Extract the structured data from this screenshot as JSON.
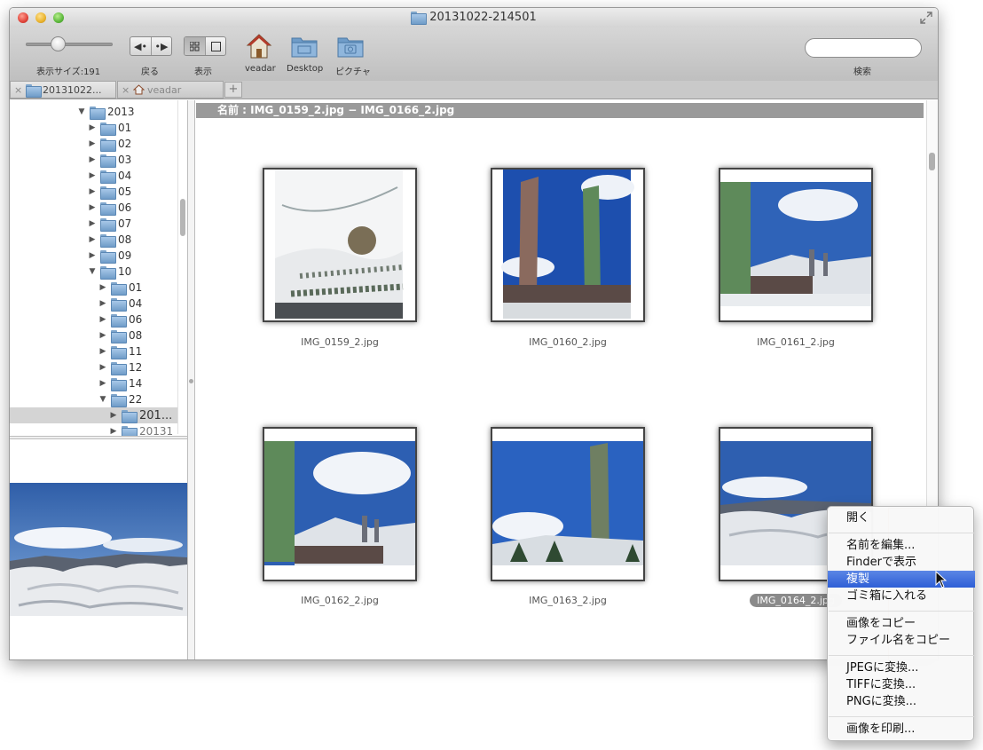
{
  "window": {
    "title": "20131022-214501"
  },
  "toolbar": {
    "size_label": "表示サイズ:191",
    "back_label": "戻る",
    "view_label": "表示",
    "back_glyphs": [
      "◀•",
      "•▶"
    ],
    "veadar_label": "veadar",
    "desktop_label": "Desktop",
    "pictures_label": "ピクチャ",
    "search_label": "検索",
    "search_value": ""
  },
  "tabs": [
    {
      "label": "20131022..."
    },
    {
      "label": "veadar"
    }
  ],
  "tree": [
    {
      "label": "2013"
    },
    {
      "label": "01"
    },
    {
      "label": "02"
    },
    {
      "label": "03"
    },
    {
      "label": "04"
    },
    {
      "label": "05"
    },
    {
      "label": "06"
    },
    {
      "label": "07"
    },
    {
      "label": "08"
    },
    {
      "label": "09"
    },
    {
      "label": "10"
    },
    {
      "label": "01"
    },
    {
      "label": "04"
    },
    {
      "label": "06"
    },
    {
      "label": "08"
    },
    {
      "label": "11"
    },
    {
      "label": "12"
    },
    {
      "label": "14"
    },
    {
      "label": "22"
    },
    {
      "label": "201..."
    },
    {
      "label": "20131"
    }
  ],
  "content": {
    "header": "名前 : IMG_0159_2.jpg − IMG_0166_2.jpg",
    "thumbnails": [
      {
        "name": "IMG_0159_2.jpg"
      },
      {
        "name": "IMG_0160_2.jpg"
      },
      {
        "name": "IMG_0161_2.jpg"
      },
      {
        "name": "IMG_0162_2.jpg"
      },
      {
        "name": "IMG_0163_2.jpg"
      },
      {
        "name": "IMG_0164_2.jpg"
      }
    ]
  },
  "context_menu": {
    "items": [
      "開く",
      "名前を編集...",
      "Finderで表示",
      "複製",
      "ゴミ箱に入れる",
      "画像をコピー",
      "ファイル名をコピー",
      "JPEGに変換...",
      "TIFFに変換...",
      "PNGに変換...",
      "画像を印刷..."
    ],
    "highlighted": "複製"
  },
  "colors": {
    "menu_highlight": "#2e5fd6",
    "header_bar": "#9a9a9a",
    "selection_outline": "#c8762f"
  }
}
